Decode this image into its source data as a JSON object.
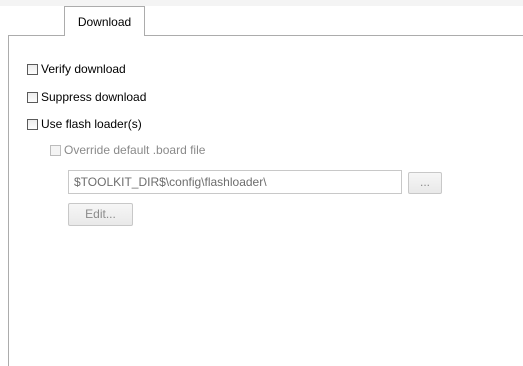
{
  "tabs": [
    {
      "label": "Download",
      "selected": true
    }
  ],
  "options": {
    "verify_download": {
      "label": "Verify download",
      "checked": false
    },
    "suppress_download": {
      "label": "Suppress download",
      "checked": false
    },
    "use_flash_loaders": {
      "label": "Use flash loader(s)",
      "checked": false
    },
    "override_board_file": {
      "label": "Override default .board file",
      "checked": false,
      "enabled": false
    }
  },
  "board_file": {
    "value": "$TOOLKIT_DIR$\\config\\flashloader\\",
    "browse_label": "...",
    "edit_label": "Edit..."
  }
}
